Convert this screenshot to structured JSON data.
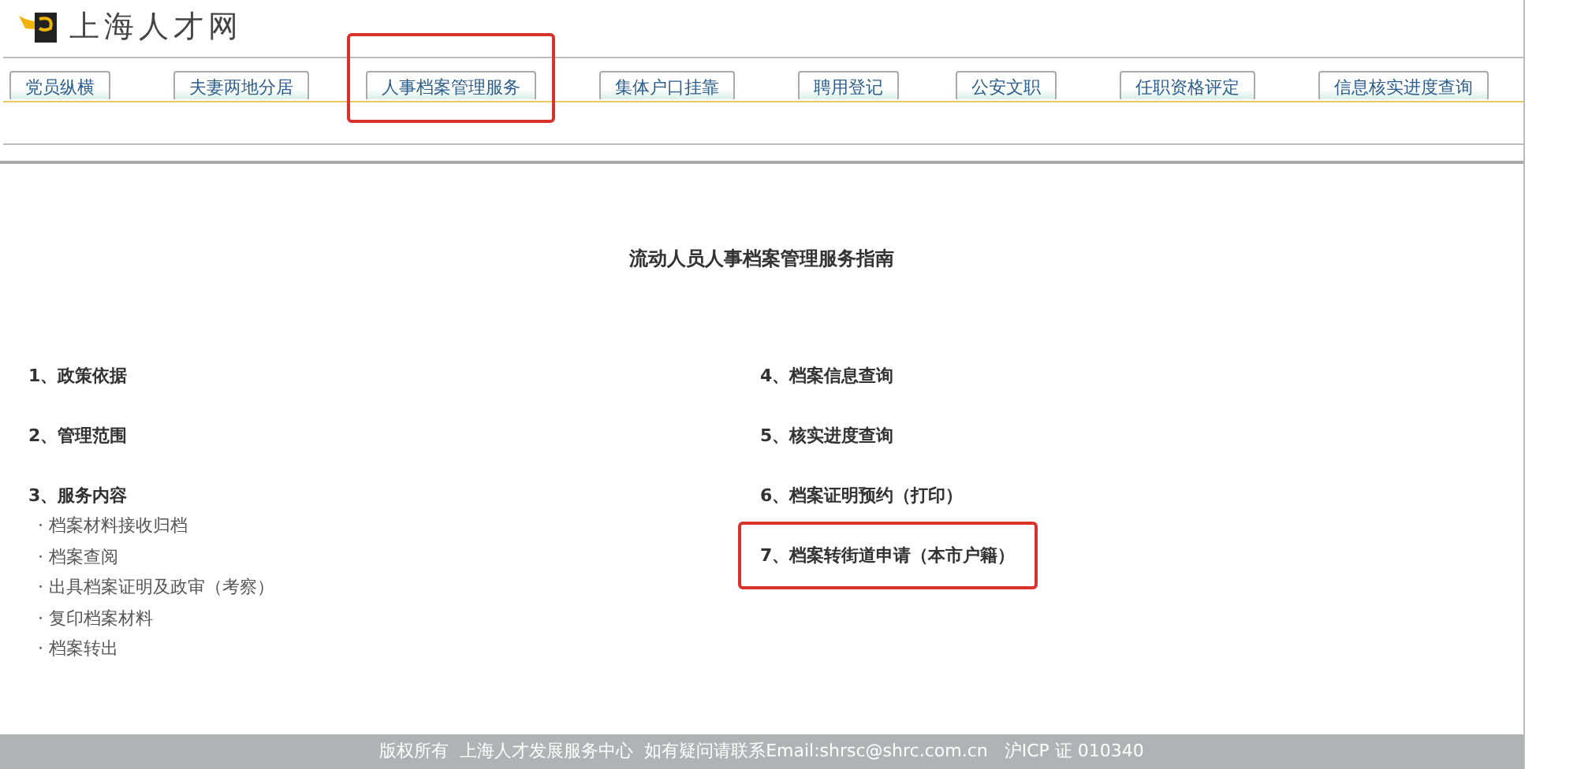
{
  "site": {
    "name": "上海人才网"
  },
  "nav_tabs": [
    {
      "label": "党员纵横",
      "highlighted": false
    },
    {
      "label": "夫妻两地分居",
      "highlighted": false
    },
    {
      "label": "人事档案管理服务",
      "highlighted": true
    },
    {
      "label": "集体户口挂靠",
      "highlighted": false
    },
    {
      "label": "聘用登记",
      "highlighted": false
    },
    {
      "label": "公安文职",
      "highlighted": false
    },
    {
      "label": "任职资格评定",
      "highlighted": false
    },
    {
      "label": "信息核实进度查询",
      "highlighted": false
    }
  ],
  "guide": {
    "title": "流动人员人事档案管理服务指南",
    "left_items": [
      {
        "label": "1、政策依据",
        "highlighted": false
      },
      {
        "label": "2、管理范围",
        "highlighted": false
      },
      {
        "label": "3、服务内容",
        "highlighted": false,
        "children": [
          "· 档案材料接收归档",
          "· 档案查阅",
          "· 出具档案证明及政审（考察）",
          "· 复印档案材料",
          "· 档案转出"
        ]
      }
    ],
    "right_items": [
      {
        "label": "4、档案信息查询",
        "highlighted": false
      },
      {
        "label": "5、核实进度查询",
        "highlighted": false
      },
      {
        "label": "6、档案证明预约（打印）",
        "highlighted": false
      },
      {
        "label": "7、档案转街道申请（本市户籍）",
        "highlighted": true
      }
    ]
  },
  "footer": "版权所有  上海人才发展服务中心  如有疑问请联系Email:shrsc@shrc.com.cn   沪ICP 证 010340"
}
